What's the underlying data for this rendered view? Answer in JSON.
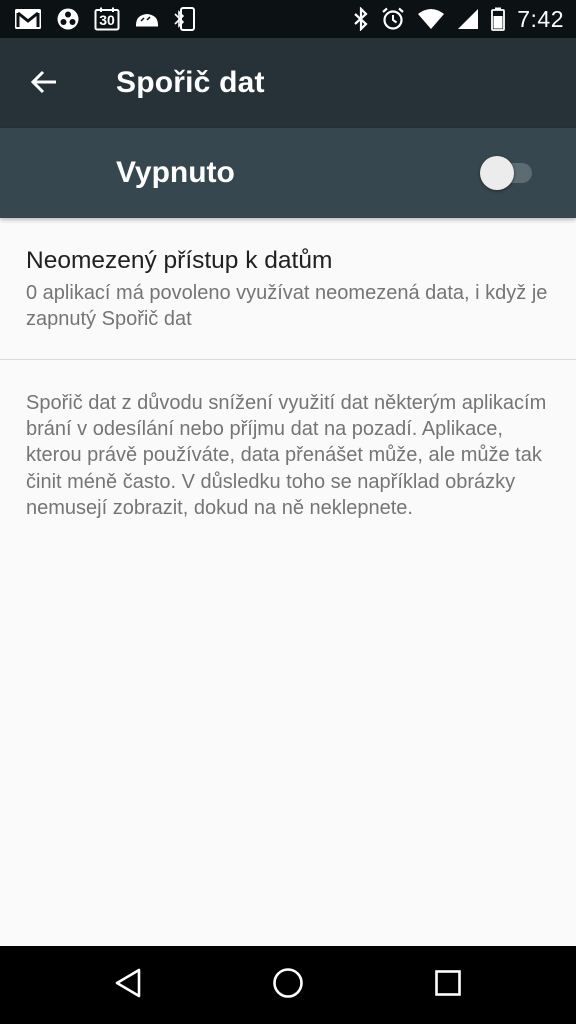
{
  "status_bar": {
    "time": "7:42",
    "left_icons": [
      "gmail-icon",
      "biohazard-icon",
      "calendar-icon",
      "cloud-icon",
      "phone-bluetooth-icon"
    ],
    "calendar_day": "30",
    "right_icons": [
      "bluetooth-icon",
      "alarm-icon",
      "wifi-icon",
      "cellular-icon",
      "battery-icon"
    ]
  },
  "toolbar": {
    "title": "Spořič dat",
    "back_icon": "arrow-back-icon"
  },
  "master_switch": {
    "label": "Vypnuto",
    "checked": false
  },
  "unrestricted_access": {
    "title": "Neomezený přístup k datům",
    "summary": "0 aplikací má povoleno využívat neomezená data, i když je zapnutý Spořič dat"
  },
  "footer": {
    "text": "Spořič dat z důvodu snížení využití dat některým aplikacím brání v odesílání nebo příjmu dat na pozadí. Aplikace, kterou právě používáte, data přenášet může, ale může tak činit méně často. V důsledku toho se například obrázky nemusejí zobrazit, dokud na ně neklepnete."
  },
  "colors": {
    "status_bar": "#0c1114",
    "toolbar": "#263238",
    "switch_bar": "#37474f",
    "background": "#fafafa",
    "nav_bar": "#000000"
  },
  "nav_bar": {
    "buttons": [
      "back-triangle-icon",
      "home-circle-icon",
      "recents-square-icon"
    ]
  }
}
